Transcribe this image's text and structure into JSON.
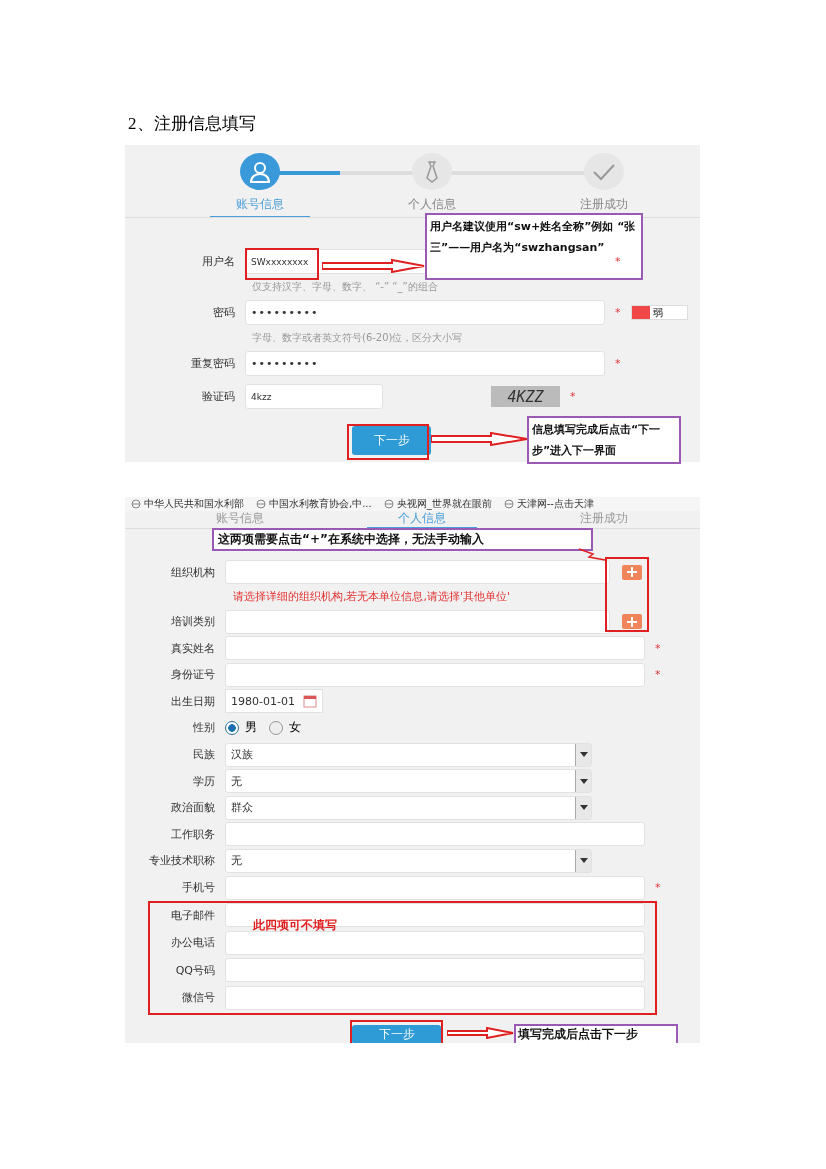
{
  "heading": "2、注册信息填写",
  "account_screen": {
    "steps": [
      {
        "label": "账号信息",
        "selected": true
      },
      {
        "label": "个人信息",
        "selected": false
      },
      {
        "label": "注册成功",
        "selected": false
      }
    ],
    "fields": [
      {
        "kind": "text",
        "label": "用户名",
        "value": "SWxxxxxxxx",
        "required_mark": "*",
        "hint": "仅支持汉字、字母、数字、 “-” “_”的组合"
      },
      {
        "kind": "password",
        "label": "密码",
        "value": "•••••••••",
        "required_mark": "*",
        "strength": {
          "label": "弱",
          "level": 0.33
        },
        "hint": "字母、数字或者英文符号(6-20)位，区分大小写"
      },
      {
        "kind": "password",
        "label": "重复密码",
        "value": "•••••••••",
        "required_mark": "*"
      },
      {
        "kind": "captcha",
        "label": "验证码",
        "value": "4kzz",
        "code": "4KZZ",
        "required_mark": "*"
      }
    ],
    "button": "下一步",
    "callouts": [
      "用户名建议使用“sw+姓名全称”例如 “张三”——用户名为“swzhangsan”",
      "信息填写完成后点击“下一步”进入下一界面"
    ]
  },
  "personal_screen": {
    "bookmarks": [
      "中华人民共和国水利部",
      "中国水利教育协会,中...",
      "央视网_世界就在眼前",
      "天津网--点击天津"
    ],
    "steps": [
      {
        "label": "账号信息",
        "selected": false
      },
      {
        "label": "个人信息",
        "selected": true
      },
      {
        "label": "注册成功",
        "selected": false
      }
    ],
    "callout_top": "这两项需要点击“+”在系统中选择，无法手动输入",
    "fields": [
      {
        "kind": "picker",
        "label": "组织机构",
        "warning": "请选择详细的组织机构,若无本单位信息,请选择'其他单位'"
      },
      {
        "kind": "picker",
        "label": "培训类别"
      },
      {
        "kind": "text",
        "label": "真实姓名",
        "required_mark": "*"
      },
      {
        "kind": "text",
        "label": "身份证号",
        "required_mark": "*"
      },
      {
        "kind": "date",
        "label": "出生日期",
        "value": "1980-01-01"
      },
      {
        "kind": "radio",
        "label": "性别",
        "options": [
          {
            "label": "男",
            "selected": true
          },
          {
            "label": "女",
            "selected": false
          }
        ]
      },
      {
        "kind": "select",
        "label": "民族",
        "value": "汉族"
      },
      {
        "kind": "select",
        "label": "学历",
        "value": "无"
      },
      {
        "kind": "select",
        "label": "政治面貌",
        "value": "群众"
      },
      {
        "kind": "text",
        "label": "工作职务"
      },
      {
        "kind": "select",
        "label": "专业技术职称",
        "value": "无"
      },
      {
        "kind": "text",
        "label": "手机号",
        "required_mark": "*"
      }
    ],
    "optional_group": {
      "note": "此四项可不填写",
      "fields": [
        {
          "kind": "text",
          "label": "电子邮件"
        },
        {
          "kind": "text",
          "label": "办公电话"
        },
        {
          "kind": "text",
          "label": "QQ号码"
        },
        {
          "kind": "text",
          "label": "微信号"
        }
      ]
    },
    "button": "下一步",
    "callout_bottom": "填写完成后点击下一步"
  }
}
